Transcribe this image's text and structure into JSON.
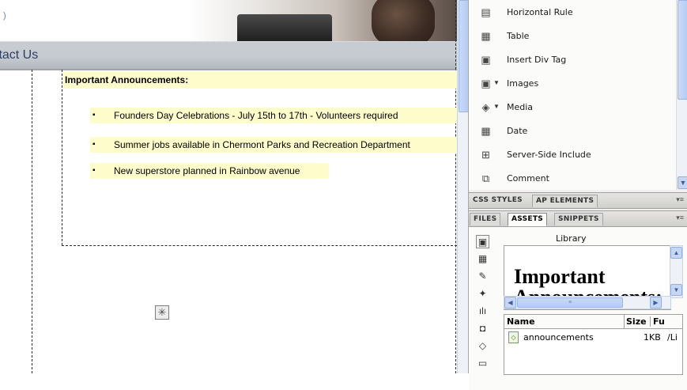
{
  "design": {
    "nav_partial": "ıtact Us",
    "heading": "Important Announcements:",
    "items": [
      "Founders Day Celebrations - July 15th to 17th - Volunteers required",
      "Summer jobs available in Chermont Parks and Recreation Department",
      "New superstore planned in Rainbow avenue"
    ],
    "bullet": "▪",
    "banner_mark": ")"
  },
  "insert_panel": {
    "items": [
      {
        "label": "Horizontal Rule",
        "icon": "horizontal-rule-icon",
        "glyph": "▤"
      },
      {
        "label": "Table",
        "icon": "table-icon",
        "glyph": "▦"
      },
      {
        "label": "Insert Div Tag",
        "icon": "div-tag-icon",
        "glyph": "▣"
      },
      {
        "label": "Images",
        "icon": "image-icon",
        "glyph": "▣",
        "has_menu": true
      },
      {
        "label": "Media",
        "icon": "media-icon",
        "glyph": "◈",
        "has_menu": true
      },
      {
        "label": "Date",
        "icon": "calendar-icon",
        "glyph": "▦"
      },
      {
        "label": "Server-Side Include",
        "icon": "server-include-icon",
        "glyph": "⊞"
      },
      {
        "label": "Comment",
        "icon": "comment-icon",
        "glyph": "⧉"
      }
    ]
  },
  "css_tabs": {
    "tab1": "CSS STYLES",
    "tab2": "AP ELEMENTS"
  },
  "files_tabs": {
    "tab1": "FILES",
    "tab2": "ASSETS",
    "tab3": "SNIPPETS"
  },
  "panel_menu_glyph": "▾≡",
  "assets": {
    "category": "Library",
    "preview_line1": "Important",
    "preview_line2": "Announcements:",
    "columns": {
      "name": "Name",
      "size": "Size",
      "path": "Fu"
    },
    "rows": [
      {
        "name": "announcements",
        "size": "1KB",
        "path": "/Li"
      }
    ]
  },
  "scroll_glyphs": {
    "up": "▲",
    "down": "▼",
    "left": "◀",
    "right": "▶",
    "grip": "≡"
  }
}
